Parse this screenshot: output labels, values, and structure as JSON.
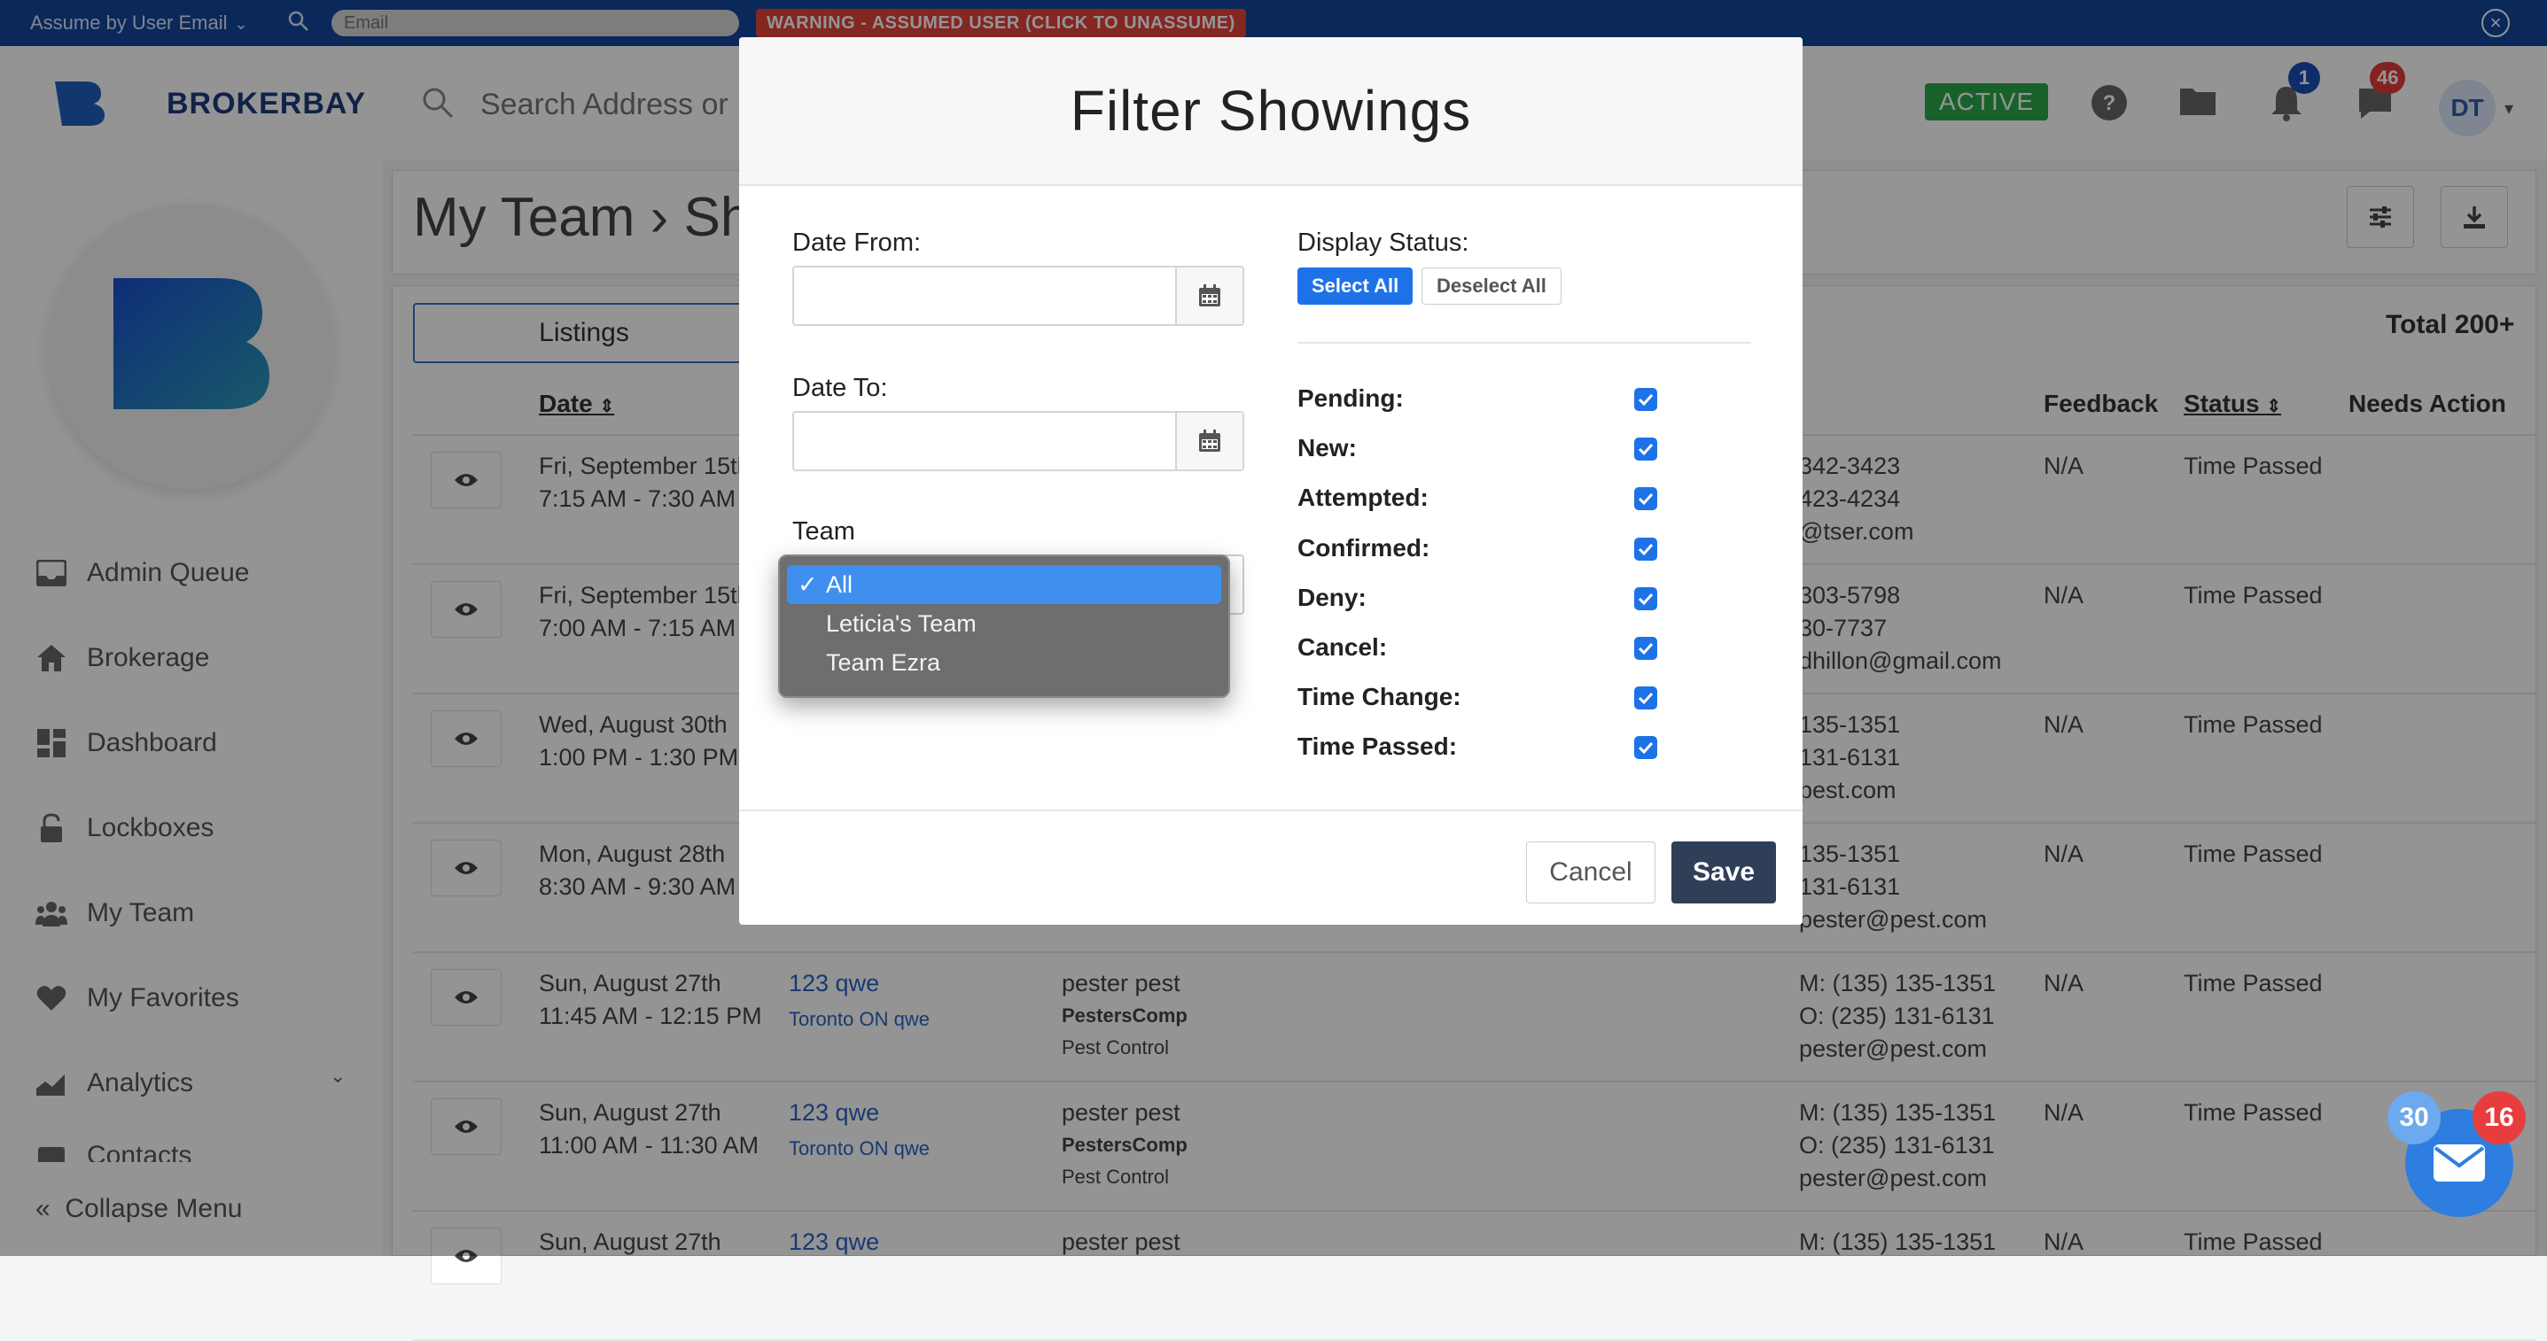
{
  "topbar": {
    "assume_label": "Assume by User Email",
    "email_placeholder": "Email",
    "warning": "WARNING - ASSUMED USER (CLICK TO UNASSUME)"
  },
  "header": {
    "brand": "BROKERBAY",
    "search_placeholder": "Search Address or",
    "status_badge": "ACTIVE",
    "notifications_count": "1",
    "messages_count": "46",
    "avatar_initials": "DT"
  },
  "sidebar": {
    "items": [
      {
        "label": "Admin Queue",
        "icon": "inbox-icon"
      },
      {
        "label": "Brokerage",
        "icon": "home-icon"
      },
      {
        "label": "Dashboard",
        "icon": "dashboard-icon"
      },
      {
        "label": "Lockboxes",
        "icon": "lock-icon"
      },
      {
        "label": "My Team",
        "icon": "team-icon"
      },
      {
        "label": "My Favorites",
        "icon": "heart-icon"
      },
      {
        "label": "Analytics",
        "icon": "chart-icon"
      },
      {
        "label": "Contacts",
        "icon": "contacts-icon"
      }
    ],
    "collapse_label": "Collapse Menu"
  },
  "page": {
    "title": "My Team › Sho",
    "tab_listings": "Listings",
    "total": "Total 200+"
  },
  "table": {
    "headers": {
      "date": "Date",
      "feedback": "Feedback",
      "status": "Status",
      "needs_action": "Needs Action"
    },
    "rows": [
      {
        "date": "Fri, September 15th",
        "time": "7:15 AM - 7:30 AM",
        "address": "",
        "city": "",
        "agent": "",
        "company": "",
        "role": "",
        "phone_m": "342-3423",
        "phone_o": "423-4234",
        "email": "@tser.com",
        "feedback": "N/A",
        "status": "Time Passed"
      },
      {
        "date": "Fri, September 15th",
        "time": "7:00 AM - 7:15 AM",
        "address": "",
        "city": "",
        "agent": "",
        "company": "",
        "role": "",
        "phone_m": "303-5798",
        "phone_o": "30-7737",
        "email": "dhillon@gmail.com",
        "feedback": "N/A",
        "status": "Time Passed"
      },
      {
        "date": "Wed, August 30th",
        "time": "1:00 PM - 1:30 PM",
        "address": "",
        "city": "",
        "agent": "",
        "company": "",
        "role": "",
        "phone_m": "135-1351",
        "phone_o": "131-6131",
        "email": "pest.com",
        "feedback": "N/A",
        "status": "Time Passed"
      },
      {
        "date": "Mon, August 28th",
        "time": "8:30 AM - 9:30 AM",
        "address": "",
        "city": "",
        "agent": "",
        "company": "",
        "role": "",
        "phone_m": "135-1351",
        "phone_o": "131-6131",
        "email": "pester@pest.com",
        "feedback": "N/A",
        "status": "Time Passed"
      },
      {
        "date": "Sun, August 27th",
        "time": "11:45 AM - 12:15 PM",
        "address": "123 qwe",
        "city": "Toronto ON qwe",
        "agent": "pester pest",
        "company": "PestersComp",
        "role": "Pest Control",
        "phone_m": "M: (135) 135-1351",
        "phone_o": "O: (235) 131-6131",
        "email": "pester@pest.com",
        "feedback": "N/A",
        "status": "Time Passed"
      },
      {
        "date": "Sun, August 27th",
        "time": "11:00 AM - 11:30 AM",
        "address": "123 qwe",
        "city": "Toronto ON qwe",
        "agent": "pester pest",
        "company": "PestersComp",
        "role": "Pest Control",
        "phone_m": "M: (135) 135-1351",
        "phone_o": "O: (235) 131-6131",
        "email": "pester@pest.com",
        "feedback": "N/A",
        "status": "Time Passed"
      },
      {
        "date": "Sun, August 27th",
        "time": "",
        "address": "123 qwe",
        "city": "",
        "agent": "pester pest",
        "company": "",
        "role": "",
        "phone_m": "M: (135) 135-1351",
        "phone_o": "",
        "email": "",
        "feedback": "N/A",
        "status": "Time Passed"
      }
    ]
  },
  "modal": {
    "title": "Filter Showings",
    "date_from_label": "Date From:",
    "date_to_label": "Date To:",
    "team_label": "Team",
    "display_status_label": "Display Status:",
    "select_all": "Select All",
    "deselect_all": "Deselect All",
    "statuses": [
      {
        "label": "Pending:",
        "checked": true
      },
      {
        "label": "New:",
        "checked": true
      },
      {
        "label": "Attempted:",
        "checked": true
      },
      {
        "label": "Confirmed:",
        "checked": true
      },
      {
        "label": "Deny:",
        "checked": true
      },
      {
        "label": "Cancel:",
        "checked": true
      },
      {
        "label": "Time Change:",
        "checked": true
      },
      {
        "label": "Time Passed:",
        "checked": true
      }
    ],
    "team_options": [
      "All",
      "Leticia's Team",
      "Team Ezra"
    ],
    "team_selected": "All",
    "cancel": "Cancel",
    "save": "Save"
  },
  "chat": {
    "unread_left": "30",
    "unread_right": "16"
  },
  "colors": {
    "topbar": "#14459e",
    "warning": "#e4433b",
    "accent": "#1e72e8",
    "active": "#2ca84a",
    "save": "#2f3f58"
  }
}
